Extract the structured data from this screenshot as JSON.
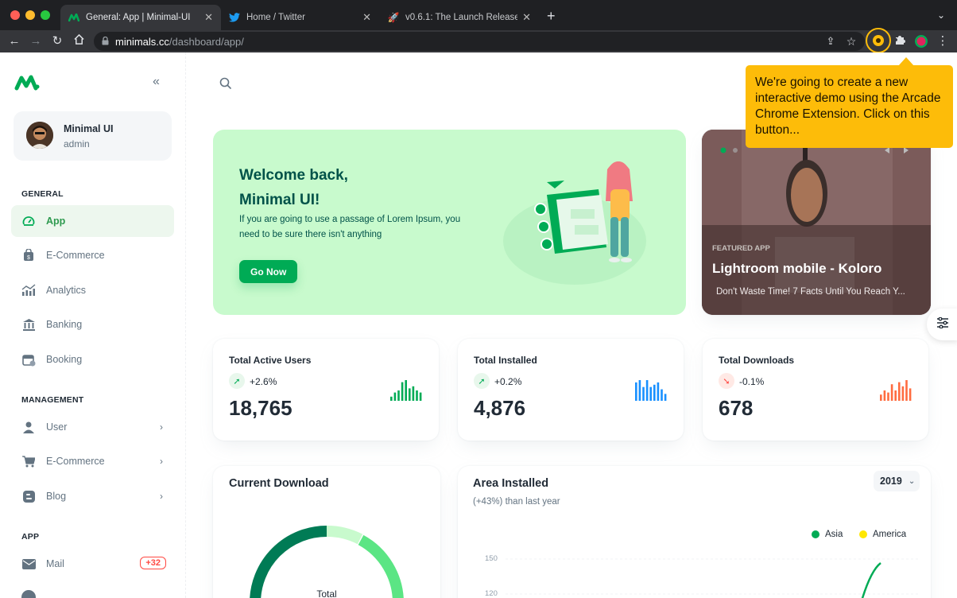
{
  "browser": {
    "tabs": [
      {
        "title": "General: App | Minimal-UI",
        "active": true
      },
      {
        "title": "Home / Twitter",
        "active": false
      },
      {
        "title": "v0.6.1: The Launch Release",
        "active": false
      }
    ],
    "url_host": "minimals.cc",
    "url_path": "/dashboard/app/",
    "colors": {
      "traffic_red": "#ff5f57",
      "traffic_yellow": "#febc2e",
      "traffic_green": "#28c840",
      "twitter_blue": "#1d9bf0"
    }
  },
  "sidebar": {
    "account": {
      "name": "Minimal UI",
      "role": "admin"
    },
    "sections": [
      {
        "label": "GENERAL",
        "items": [
          {
            "label": "App",
            "icon": "app-icon",
            "active": true
          },
          {
            "label": "E-Commerce",
            "icon": "shopping-bag-icon"
          },
          {
            "label": "Analytics",
            "icon": "analytics-icon"
          },
          {
            "label": "Banking",
            "icon": "bank-icon"
          },
          {
            "label": "Booking",
            "icon": "calendar-icon"
          }
        ]
      },
      {
        "label": "MANAGEMENT",
        "items": [
          {
            "label": "User",
            "icon": "user-icon",
            "chevron": true
          },
          {
            "label": "E-Commerce",
            "icon": "cart-icon",
            "chevron": true
          },
          {
            "label": "Blog",
            "icon": "blog-icon",
            "chevron": true
          }
        ]
      },
      {
        "label": "APP",
        "items": [
          {
            "label": "Mail",
            "icon": "mail-icon",
            "badge": "+32"
          }
        ]
      }
    ]
  },
  "welcome": {
    "title_line1": "Welcome back,",
    "title_line2": "Minimal UI!",
    "description": "If you are going to use a passage of Lorem Ipsum, you need to be sure there isn't anything",
    "button": "Go Now"
  },
  "featured": {
    "kicker": "FEATURED APP",
    "title": "Lightroom mobile - Koloro",
    "subtitle": "Don't Waste Time! 7 Facts Until You Reach Y..."
  },
  "stats": [
    {
      "title": "Total Active Users",
      "percent": "+2.6%",
      "value": "18,765",
      "trend": "up",
      "color": "#00ab55",
      "bars": [
        2,
        4,
        5,
        9,
        10,
        6,
        7,
        5,
        4
      ]
    },
    {
      "title": "Total Installed",
      "percent": "+0.2%",
      "value": "4,876",
      "trend": "up",
      "color": "#1890ff",
      "bars": [
        8,
        9,
        6,
        9,
        6,
        7,
        8,
        5,
        3
      ]
    },
    {
      "title": "Total Downloads",
      "percent": "-0.1%",
      "value": "678",
      "trend": "down",
      "color": "#ff6c40",
      "bars": [
        3,
        5,
        4,
        8,
        5,
        9,
        7,
        10,
        6
      ]
    }
  ],
  "current_download": {
    "title": "Current Download",
    "center_label": "Total"
  },
  "area_installed": {
    "title": "Area Installed",
    "subtitle": "(+43%) than last year",
    "year": "2019",
    "legend": [
      {
        "name": "Asia",
        "color": "#00ab55"
      },
      {
        "name": "America",
        "color": "#ffe700"
      }
    ],
    "y_ticks": [
      "150",
      "120"
    ]
  },
  "tooltip": {
    "text": "We're going to create a new interactive demo using the Arcade Chrome Extension. Click on this button..."
  }
}
